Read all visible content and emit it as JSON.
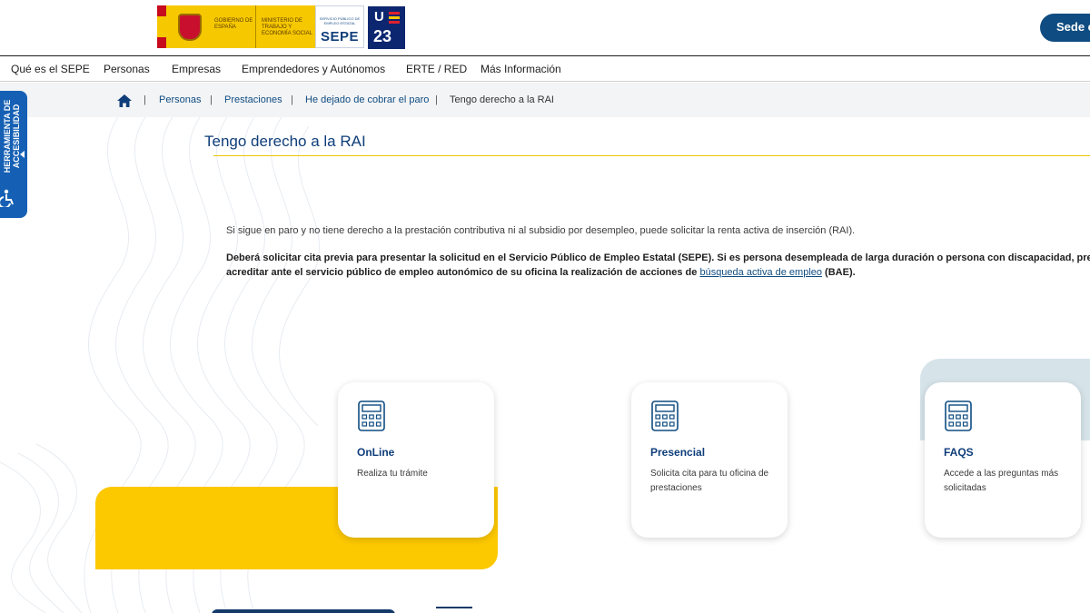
{
  "header": {
    "gov_line1": "GOBIERNO DE ESPAÑA",
    "gov_line2": "MINISTERIO DE TRABAJO Y ECONOMÍA SOCIAL",
    "sepe_small": "SERVICIO PÚBLICO DE EMPLEO ESTATAL",
    "sepe_word": "SEPE",
    "ue_letter": "U",
    "ue_number": "23",
    "sede_label": "Sede el"
  },
  "nav": {
    "items": [
      "Qué es el SEPE",
      "Personas",
      "Empresas",
      "Emprendedores y Autónomos",
      "ERTE / RED",
      "Más Información"
    ]
  },
  "breadcrumb": {
    "separator": "|",
    "items": [
      "Personas",
      "Prestaciones",
      "He dejado de cobrar el paro",
      "Tengo derecho a la RAI"
    ]
  },
  "accessibility": {
    "label_line1": "HERRAMIENTA DE",
    "label_line2": "ACCESIBILIDAD"
  },
  "page": {
    "title": "Tengo derecho a la RAI",
    "intro": "Si sigue en paro y no tiene derecho a la prestación contributiva ni al subsidio por desempleo, puede solicitar la renta activa de inserción (RAI).",
    "bold_line1": "Deberá solicitar cita previa para presentar la solicitud en el Servicio Público de Empleo Estatal (SEPE). Si es persona desempleada de larga duración o persona con discapacidad, pre",
    "bold_line2_before": "acreditar ante el servicio público de empleo autonómico de su oficina la realización de acciones de ",
    "bold_link": "búsqueda activa de empleo",
    "bold_line2_after": " (BAE)."
  },
  "cards": [
    {
      "title": "OnLine",
      "desc": "Realiza tu trámite",
      "icon": "calculator-icon"
    },
    {
      "title": "Presencial",
      "desc": "Solicita cita para tu oficina de prestaciones",
      "icon": "calculator-icon"
    },
    {
      "title": "FAQS",
      "desc": "Accede a las preguntas más solicitadas",
      "icon": "calculator-icon"
    }
  ],
  "colors": {
    "brand_blue": "#0f3e7a",
    "link_blue": "#0f4c81",
    "accent_yellow": "#fcc800",
    "accessibility_blue": "#1560b4"
  }
}
